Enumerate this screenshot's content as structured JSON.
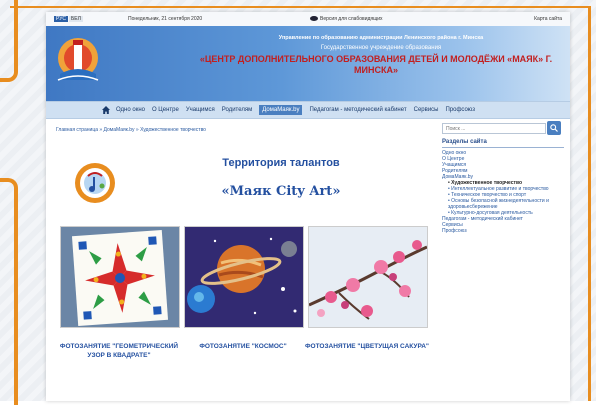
{
  "topbar": {
    "lang": [
      "РУС",
      "БЕЛ"
    ],
    "date": "Понедельник, 21 сентября 2020",
    "vision": "Версия для слабовидящих",
    "sitemap": "Карта сайта"
  },
  "header": {
    "line1": "Управление по образованию администрации Ленинского района г. Минска",
    "line2": "Государственное учреждение образования",
    "line3": "«ЦЕНТР ДОПОЛНИТЕЛЬНОГО ОБРАЗОВАНИЯ ДЕТЕЙ И МОЛОДЁЖИ «МАЯК» Г. МИНСКА»"
  },
  "nav": [
    "Одно окно",
    "О Центре",
    "Учащимся",
    "Родителям",
    "ДомаМаяк.by",
    "Педагогам - методический кабинет",
    "Сервисы",
    "Профсоюз"
  ],
  "breadcrumb": "Главная страница » ДомаМаяк.by » Художественное творчество",
  "search": {
    "placeholder": "Поиск ..."
  },
  "sidebar": {
    "title": "Разделы сайта",
    "items": [
      {
        "label": "Одно окно",
        "level": 0
      },
      {
        "label": "О Центре",
        "level": 0
      },
      {
        "label": "Учащимся",
        "level": 0
      },
      {
        "label": "Родителям",
        "level": 0
      },
      {
        "label": "ДомаМаяк.by",
        "level": 0
      },
      {
        "label": "• Художественное творчество",
        "level": 1,
        "current": true
      },
      {
        "label": "• Интеллектуальное развитие и творчество",
        "level": 1
      },
      {
        "label": "• Техническое творчество и спорт",
        "level": 1
      },
      {
        "label": "• Основы безопасной жизнедеятельности и здоровьесбережение",
        "level": 1
      },
      {
        "label": "• Культурно-досуговая деятельность",
        "level": 1
      },
      {
        "label": "Педагогам - методический кабинет",
        "level": 0
      },
      {
        "label": "Сервисы",
        "level": 0
      },
      {
        "label": "Профсоюз",
        "level": 0
      }
    ]
  },
  "main": {
    "title": "Территория талантов",
    "subtitle": "«Маяк City Art»",
    "gallery": [
      {
        "caption": "ФОТОЗАНЯТИЕ \"ГЕОМЕТРИЧЕСКИЙ УЗОР В КВАДРАТЕ\""
      },
      {
        "caption": "ФОТОЗАНЯТИЕ \"КОСМОС\""
      },
      {
        "caption": "ФОТОЗАНЯТИЕ \"ЦВЕТУЩАЯ САКУРА\""
      }
    ]
  },
  "colors": {
    "frame": "#e88d1f",
    "accent": "#2450a0",
    "header_red": "#c21f1f"
  }
}
